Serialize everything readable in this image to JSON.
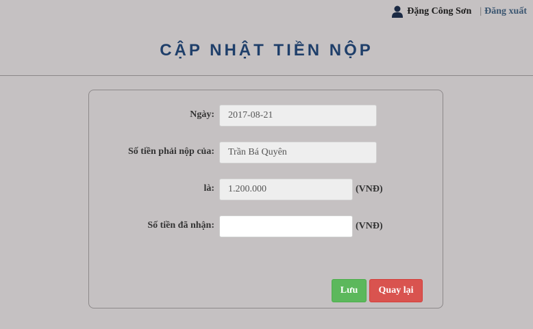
{
  "header": {
    "user_icon": "user-icon",
    "user_name": "Đặng Công Sơn",
    "separator": "|",
    "logout_label": "Đăng xuất"
  },
  "page": {
    "title": "CẬP NHẬT TIỀN NỘP"
  },
  "form": {
    "date": {
      "label": "Ngày:",
      "value": "2017-08-21"
    },
    "payer": {
      "label": "Số tiền phải nộp của:",
      "value": "Trần Bá Quyên"
    },
    "amount_due": {
      "label": "là:",
      "value": "1.200.000",
      "unit": "(VNĐ)"
    },
    "amount_received": {
      "label": "Số tiền đã nhận:",
      "value": "",
      "unit": "(VNĐ)"
    },
    "save_label": "Lưu",
    "back_label": "Quay lại"
  },
  "colors": {
    "background": "#c5c1c2",
    "title": "#1f3f6a",
    "save_button": "#5cb85c",
    "back_button": "#d9534f"
  }
}
